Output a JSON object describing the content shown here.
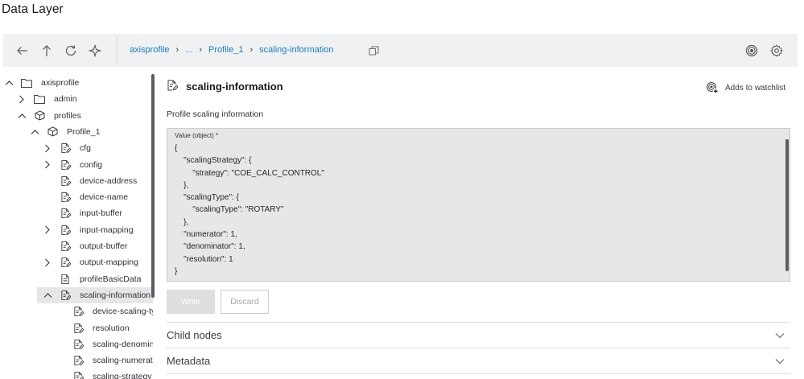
{
  "app": {
    "title": "Data Layer"
  },
  "toolbar": {
    "breadcrumb": [
      "axisprofile",
      "...",
      "Profile_1",
      "scaling-information"
    ],
    "buttons": [
      "back-arrow-icon",
      "up-arrow-icon",
      "refresh-icon",
      "locate-icon",
      "copy-icon",
      "watchlist-icon",
      "settings-gear-icon"
    ]
  },
  "tree": {
    "items": [
      {
        "label": "axisprofile",
        "expander": "expanded",
        "icon": "folder-icon"
      },
      {
        "label": "admin",
        "expander": "collapsed",
        "icon": "folder-icon"
      },
      {
        "label": "profiles",
        "expander": "expanded",
        "icon": "cube-icon"
      },
      {
        "label": "Profile_1",
        "expander": "expanded",
        "icon": "cube-icon"
      },
      {
        "label": "cfg",
        "expander": "collapsed",
        "icon": "document-edit-icon"
      },
      {
        "label": "config",
        "expander": "collapsed",
        "icon": "document-edit-icon"
      },
      {
        "label": "device-address",
        "expander": "none",
        "icon": "document-edit-icon"
      },
      {
        "label": "device-name",
        "expander": "none",
        "icon": "document-edit-icon"
      },
      {
        "label": "input-buffer",
        "expander": "none",
        "icon": "document-edit-icon"
      },
      {
        "label": "input-mapping",
        "expander": "collapsed",
        "icon": "document-edit-icon"
      },
      {
        "label": "output-buffer",
        "expander": "none",
        "icon": "document-edit-icon"
      },
      {
        "label": "output-mapping",
        "expander": "collapsed",
        "icon": "document-edit-icon"
      },
      {
        "label": "profileBasicData",
        "expander": "none",
        "icon": "document-icon"
      },
      {
        "label": "scaling-information",
        "expander": "expanded",
        "icon": "document-edit-icon",
        "selected": true
      },
      {
        "label": "device-scaling-ty",
        "expander": "none",
        "icon": "document-edit-icon"
      },
      {
        "label": "resolution",
        "expander": "none",
        "icon": "document-edit-icon"
      },
      {
        "label": "scaling-denomin",
        "expander": "none",
        "icon": "document-edit-icon"
      },
      {
        "label": "scaling-numerato",
        "expander": "none",
        "icon": "document-edit-icon"
      },
      {
        "label": "scaling-strategy",
        "expander": "none",
        "icon": "document-edit-icon"
      }
    ]
  },
  "node": {
    "title": "scaling-information",
    "watchlist_label": "Adds to watchlist",
    "description": "Profile scaling information",
    "value_label": "Value (object) *",
    "value_json": "{\n    \"scalingStrategy\": {\n        \"strategy\": \"COE_CALC_CONTROL\"\n    },\n    \"scalingType\": {\n        \"scalingType\": \"ROTARY\"\n    },\n    \"numerator\": 1,\n    \"denominator\": 1,\n    \"resolution\": 1\n}",
    "write_label": "Write",
    "discard_label": "Discard"
  },
  "sections": [
    {
      "label": "Child nodes"
    },
    {
      "label": "Metadata"
    }
  ]
}
